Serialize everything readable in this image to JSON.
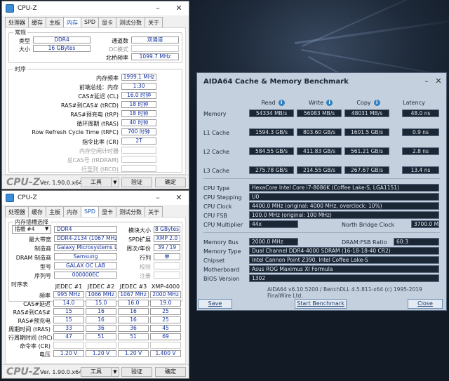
{
  "colors": {
    "accent_blue": "#1f5ab4",
    "value_blue": "#1533a0",
    "aida_panel": "#c4d0de",
    "aida_box": "#1c2735"
  },
  "cpuz_top": {
    "title": "CPU-Z",
    "tabs": [
      "处理器",
      "缓存",
      "主板",
      "内存",
      "SPD",
      "显卡",
      "测试分数",
      "关于"
    ],
    "active_tab": "内存",
    "general": {
      "title": "常规",
      "type_label": "类型",
      "type_value": "DDR4",
      "size_label": "大小",
      "size_value": "16 GBytes",
      "channel_label": "通道数",
      "channel_value": "双通道",
      "dc_label": "DC模式",
      "dc_value": "",
      "nb_label": "北桥频率",
      "nb_value": "1099.7 MHz"
    },
    "timings": {
      "title": "时序",
      "rows": [
        {
          "label": "内存频率",
          "value": "1999.1 MHz",
          "dim": false
        },
        {
          "label": "前端总线：内存",
          "value": "1:30",
          "dim": false
        },
        {
          "label": "CAS#延迟 (CL)",
          "value": "16.0 时钟",
          "dim": false
        },
        {
          "label": "RAS#到CAS# (tRCD)",
          "value": "18 时钟",
          "dim": false
        },
        {
          "label": "RAS#预充电 (tRP)",
          "value": "18 时钟",
          "dim": false
        },
        {
          "label": "循环周期 (tRAS)",
          "value": "40 时钟",
          "dim": false
        },
        {
          "label": "Row Refresh Cycle Time (tRFC)",
          "value": "700 时钟",
          "dim": false
        },
        {
          "label": "指令比率 (CR)",
          "value": "2T",
          "dim": false
        },
        {
          "label": "内存空闲计时器",
          "value": "",
          "dim": true
        },
        {
          "label": "总CAS号 (tRDRAM)",
          "value": "",
          "dim": true
        },
        {
          "label": "行至列 (tRCD)",
          "value": "",
          "dim": true
        }
      ]
    },
    "status": {
      "logo": "CPU-Z",
      "version": "Ver. 1.90.0.x64",
      "tools": "工具",
      "validate": "验证",
      "ok": "确定"
    }
  },
  "cpuz_bottom": {
    "title": "CPU-Z",
    "tabs": [
      "处理器",
      "缓存",
      "主板",
      "内存",
      "SPD",
      "显卡",
      "测试分数",
      "关于"
    ],
    "active_tab": "SPD",
    "slot_title": "内存插槽选择",
    "slot_value": "插槽 #4",
    "slot_type": "DDR4",
    "module_size_label": "模块大小",
    "module_size_value": "8 GBytes",
    "max_bw_label": "最大带宽",
    "max_bw_value": "DDR4-2134 (1067 MHz)",
    "spd_ext_label": "SPD扩展",
    "spd_ext_value": "XMP 2.0",
    "maker_label": "制造商",
    "maker_value": "Galaxy Microsystems Ltd.",
    "week_label": "周次/年份",
    "week_value": "39 / 19",
    "dram_label": "DRAM 制造商",
    "dram_value": "Samsung",
    "rank_label": "行列",
    "rank_value": "单",
    "model_label": "型号",
    "model_value": "GALAX OC LAB",
    "check_label": "校验",
    "check_value": "",
    "serial_label": "序列号",
    "serial_value": "000000EC",
    "reg_label": "注册",
    "reg_value": "",
    "timing_table": {
      "title": "时序表",
      "headers": [
        "JEDEC #1",
        "JEDEC #2",
        "JEDEC #3",
        "XMP-4000"
      ],
      "rows": [
        {
          "label": "频率",
          "values": [
            "995 MHz",
            "1066 MHz",
            "1067 MHz",
            "2000 MHz"
          ]
        },
        {
          "label": "CAS#延迟",
          "values": [
            "14.0",
            "15.0",
            "16.0",
            "19.0"
          ]
        },
        {
          "label": "RAS#到CAS#",
          "values": [
            "15",
            "16",
            "16",
            "25"
          ]
        },
        {
          "label": "RAS#预充电",
          "values": [
            "15",
            "16",
            "16",
            "25"
          ]
        },
        {
          "label": "周期时间 (tRAS)",
          "values": [
            "33",
            "36",
            "36",
            "45"
          ]
        },
        {
          "label": "行周期时间 (tRC)",
          "values": [
            "47",
            "51",
            "51",
            "69"
          ]
        },
        {
          "label": "命令率 (CR)",
          "values": [
            "",
            "",
            "",
            ""
          ]
        },
        {
          "label": "电压",
          "values": [
            "1.20 V",
            "1.20 V",
            "1.20 V",
            "1.400 V"
          ]
        }
      ]
    },
    "status": {
      "logo": "CPU-Z",
      "version": "Ver. 1.90.0.x64",
      "tools": "工具",
      "validate": "验证",
      "ok": "确定"
    }
  },
  "aida": {
    "title": "AIDA64 Cache & Memory Benchmark",
    "columns": [
      "Read",
      "Write",
      "Copy",
      "Latency"
    ],
    "bench_rows": [
      {
        "label": "Memory",
        "values": [
          "54334 MB/s",
          "56083 MB/s",
          "48031 MB/s",
          "48.0 ns"
        ]
      },
      {
        "label": "L1 Cache",
        "values": [
          "1594.3 GB/s",
          "803.60 GB/s",
          "1601.5 GB/s",
          "0.9 ns"
        ]
      },
      {
        "label": "L2 Cache",
        "values": [
          "584.55 GB/s",
          "411.83 GB/s",
          "561.21 GB/s",
          "2.8 ns"
        ]
      },
      {
        "label": "L3 Cache",
        "values": [
          "275.78 GB/s",
          "214.55 GB/s",
          "267.67 GB/s",
          "13.4 ns"
        ]
      }
    ],
    "cpu_type_label": "CPU Type",
    "cpu_type": "HexaCore Intel Core i7-8086K  (Coffee Lake-S, LGA1151)",
    "cpu_stepping_label": "CPU Stepping",
    "cpu_stepping": "U0",
    "cpu_clock_label": "CPU Clock",
    "cpu_clock": "4400.0 MHz  (original: 4000 MHz, overclock: 10%)",
    "cpu_fsb_label": "CPU FSB",
    "cpu_fsb": "100.0 MHz  (original: 100 MHz)",
    "cpu_mult_label": "CPU Multiplier",
    "cpu_mult": "44x",
    "nb_clock_label": "North Bridge Clock",
    "nb_clock": "3700.0 MHz",
    "mem_bus_label": "Memory Bus",
    "mem_bus": "2000.0 MHz",
    "dram_ratio_label": "DRAM:FSB Ratio",
    "dram_ratio": "60:3",
    "mem_type_label": "Memory Type",
    "mem_type": "Dual Channel DDR4-4000 SDRAM  (16-18-18-40 CR2)",
    "chipset_label": "Chipset",
    "chipset": "Intel Cannon Point Z390, Intel Coffee Lake-S",
    "mobo_label": "Motherboard",
    "mobo": "Asus ROG Maximus XI Formula",
    "bios_label": "BIOS Version",
    "bios": "1302",
    "footer": "AIDA64 v6.10.5200 / BenchDLL 4.5.811-x64  (c) 1995-2019 FinalWire Ltd.",
    "save": "Save",
    "start": "Start Benchmark",
    "close": "Close"
  }
}
